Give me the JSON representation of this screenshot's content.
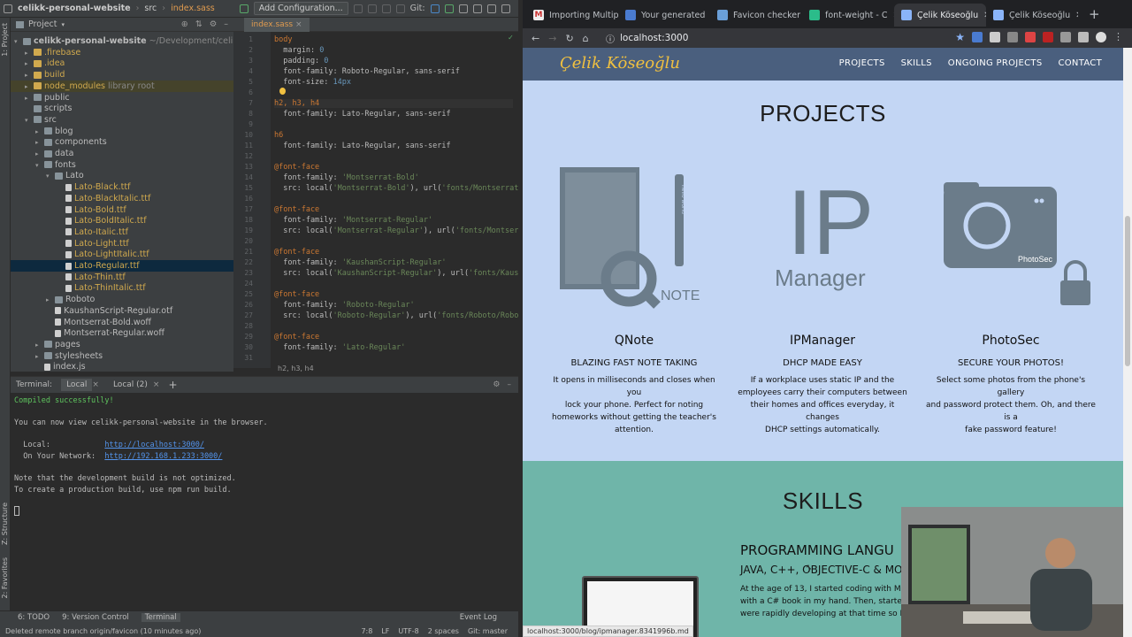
{
  "ide": {
    "breadcrumb_project": "celikk-personal-website",
    "breadcrumb_folder": "src",
    "breadcrumb_file": "index.sass",
    "add_config": "Add Configuration...",
    "git_label": "Git:",
    "project_label": "Project",
    "side_project_label": "1: Project",
    "side_structure_label": "Z: Structure",
    "side_favorites_label": "2: Favorites",
    "tree": [
      {
        "label": "celikk-personal-website",
        "extra": " ~/Development/celikk-person",
        "indent": 0,
        "arrow": "▾",
        "kind": "fold",
        "bold": true
      },
      {
        "label": ".firebase",
        "indent": 1,
        "arrow": "▸",
        "kind": "fold",
        "color": "#d0a94e"
      },
      {
        "label": ".idea",
        "indent": 1,
        "arrow": "▸",
        "kind": "fold",
        "color": "#d0a94e"
      },
      {
        "label": "build",
        "indent": 1,
        "arrow": "▸",
        "kind": "fold",
        "color": "#d0a94e"
      },
      {
        "label": "node_modules",
        "extra": " library root",
        "indent": 1,
        "arrow": "▸",
        "kind": "fold",
        "color": "#d0a94e",
        "hl": true
      },
      {
        "label": "public",
        "indent": 1,
        "arrow": "▸",
        "kind": "fold"
      },
      {
        "label": "scripts",
        "indent": 1,
        "arrow": "",
        "kind": "fold"
      },
      {
        "label": "src",
        "indent": 1,
        "arrow": "▾",
        "kind": "fold"
      },
      {
        "label": "blog",
        "indent": 2,
        "arrow": "▸",
        "kind": "fold"
      },
      {
        "label": "components",
        "indent": 2,
        "arrow": "▸",
        "kind": "fold"
      },
      {
        "label": "data",
        "indent": 2,
        "arrow": "▸",
        "kind": "fold"
      },
      {
        "label": "fonts",
        "indent": 2,
        "arrow": "▾",
        "kind": "fold"
      },
      {
        "label": "Lato",
        "indent": 3,
        "arrow": "▾",
        "kind": "fold"
      },
      {
        "label": "Lato-Black.ttf",
        "indent": 4,
        "arrow": "",
        "kind": "file",
        "color": "#d0a94e"
      },
      {
        "label": "Lato-BlackItalic.ttf",
        "indent": 4,
        "arrow": "",
        "kind": "file",
        "color": "#d0a94e"
      },
      {
        "label": "Lato-Bold.ttf",
        "indent": 4,
        "arrow": "",
        "kind": "file",
        "color": "#d0a94e"
      },
      {
        "label": "Lato-BoldItalic.ttf",
        "indent": 4,
        "arrow": "",
        "kind": "file",
        "color": "#d0a94e"
      },
      {
        "label": "Lato-Italic.ttf",
        "indent": 4,
        "arrow": "",
        "kind": "file",
        "color": "#d0a94e"
      },
      {
        "label": "Lato-Light.ttf",
        "indent": 4,
        "arrow": "",
        "kind": "file",
        "color": "#d0a94e"
      },
      {
        "label": "Lato-LightItalic.ttf",
        "indent": 4,
        "arrow": "",
        "kind": "file",
        "color": "#d0a94e"
      },
      {
        "label": "Lato-Regular.ttf",
        "indent": 4,
        "arrow": "",
        "kind": "file",
        "color": "#d0a94e",
        "sel": true
      },
      {
        "label": "Lato-Thin.ttf",
        "indent": 4,
        "arrow": "",
        "kind": "file",
        "color": "#d0a94e"
      },
      {
        "label": "Lato-ThinItalic.ttf",
        "indent": 4,
        "arrow": "",
        "kind": "file",
        "color": "#d0a94e"
      },
      {
        "label": "Roboto",
        "indent": 3,
        "arrow": "▸",
        "kind": "fold"
      },
      {
        "label": "KaushanScript-Regular.otf",
        "indent": 3,
        "arrow": "",
        "kind": "file"
      },
      {
        "label": "Montserrat-Bold.woff",
        "indent": 3,
        "arrow": "",
        "kind": "file"
      },
      {
        "label": "Montserrat-Regular.woff",
        "indent": 3,
        "arrow": "",
        "kind": "file"
      },
      {
        "label": "pages",
        "indent": 2,
        "arrow": "▸",
        "kind": "fold"
      },
      {
        "label": "stylesheets",
        "indent": 2,
        "arrow": "▸",
        "kind": "fold"
      },
      {
        "label": "index.js",
        "indent": 2,
        "arrow": "",
        "kind": "file"
      }
    ],
    "editor_tab": "index.sass",
    "code": [
      [
        {
          "t": "body",
          "c": "k"
        }
      ],
      [
        {
          "t": "  margin: ",
          "c": "p"
        },
        {
          "t": "0",
          "c": "n"
        }
      ],
      [
        {
          "t": "  padding: ",
          "c": "p"
        },
        {
          "t": "0",
          "c": "n"
        }
      ],
      [
        {
          "t": "  font-family: Roboto-Regular, sans-serif",
          "c": "p"
        }
      ],
      [
        {
          "t": "  font-size: ",
          "c": "p"
        },
        {
          "t": "14px",
          "c": "n"
        }
      ],
      [
        {
          "t": "",
          "c": "p"
        }
      ],
      [
        {
          "t": "h2, h3, h4",
          "c": "k"
        }
      ],
      [
        {
          "t": "  font-family: Lato-Regular, sans-serif",
          "c": "p"
        }
      ],
      [
        {
          "t": "",
          "c": "p"
        }
      ],
      [
        {
          "t": "h6",
          "c": "k"
        }
      ],
      [
        {
          "t": "  font-family: Lato-Regular, sans-serif",
          "c": "p"
        }
      ],
      [
        {
          "t": "",
          "c": "p"
        }
      ],
      [
        {
          "t": "@font-face",
          "c": "k"
        }
      ],
      [
        {
          "t": "  font-family: ",
          "c": "p"
        },
        {
          "t": "'Montserrat-Bold'",
          "c": "s"
        }
      ],
      [
        {
          "t": "  src: local(",
          "c": "p"
        },
        {
          "t": "'Montserrat-Bold'",
          "c": "s"
        },
        {
          "t": "), url(",
          "c": "p"
        },
        {
          "t": "'fonts/Montserrat-Bold",
          "c": "s"
        }
      ],
      [
        {
          "t": "",
          "c": "p"
        }
      ],
      [
        {
          "t": "@font-face",
          "c": "k"
        }
      ],
      [
        {
          "t": "  font-family: ",
          "c": "p"
        },
        {
          "t": "'Montserrat-Regular'",
          "c": "s"
        }
      ],
      [
        {
          "t": "  src: local(",
          "c": "p"
        },
        {
          "t": "'Montserrat-Regular'",
          "c": "s"
        },
        {
          "t": "), url(",
          "c": "p"
        },
        {
          "t": "'fonts/Montserrat-R",
          "c": "s"
        }
      ],
      [
        {
          "t": "",
          "c": "p"
        }
      ],
      [
        {
          "t": "@font-face",
          "c": "k"
        }
      ],
      [
        {
          "t": "  font-family: ",
          "c": "p"
        },
        {
          "t": "'KaushanScript-Regular'",
          "c": "s"
        }
      ],
      [
        {
          "t": "  src: local(",
          "c": "p"
        },
        {
          "t": "'KaushanScript-Regular'",
          "c": "s"
        },
        {
          "t": "), url(",
          "c": "p"
        },
        {
          "t": "'fonts/Kaushan",
          "c": "s"
        }
      ],
      [
        {
          "t": "",
          "c": "p"
        }
      ],
      [
        {
          "t": "@font-face",
          "c": "k"
        }
      ],
      [
        {
          "t": "  font-family: ",
          "c": "p"
        },
        {
          "t": "'Roboto-Regular'",
          "c": "s"
        }
      ],
      [
        {
          "t": "  src: local(",
          "c": "p"
        },
        {
          "t": "'Roboto-Regular'",
          "c": "s"
        },
        {
          "t": "), url(",
          "c": "p"
        },
        {
          "t": "'fonts/Roboto/Roboto-Re",
          "c": "s"
        }
      ],
      [
        {
          "t": "",
          "c": "p"
        }
      ],
      [
        {
          "t": "@font-face",
          "c": "k"
        }
      ],
      [
        {
          "t": "  font-family: ",
          "c": "p"
        },
        {
          "t": "'Lato-Regular'",
          "c": "s"
        }
      ],
      [
        {
          "t": "",
          "c": "p"
        }
      ]
    ],
    "editor_crumb": "h2, h3, h4",
    "terminal_label": "Terminal:",
    "terminal_tabs": [
      "Local",
      "Local (2)"
    ],
    "terminal_lines": [
      {
        "t": "Compiled successfully!",
        "c": "grn"
      },
      {
        "t": "",
        "c": ""
      },
      {
        "t": "You can now view celikk-personal-website in the browser.",
        "c": ""
      },
      {
        "t": "",
        "c": ""
      },
      {
        "t": "  Local:            ",
        "c": "",
        "link": "http://localhost:3000/"
      },
      {
        "t": "  On Your Network:  ",
        "c": "",
        "link": "http://192.168.1.233:3000/"
      },
      {
        "t": "",
        "c": ""
      },
      {
        "t": "Note that the development build is not optimized.",
        "c": ""
      },
      {
        "t": "To create a production build, use npm run build.",
        "c": ""
      }
    ],
    "bottom_tools": [
      "6: TODO",
      "9: Version Control",
      "Terminal"
    ],
    "event_log": "Event Log",
    "status_left": "Deleted remote branch origin/favicon (10 minutes ago)",
    "status_right": [
      "7:8",
      "LF",
      "UTF-8",
      "2 spaces",
      "Git: master"
    ]
  },
  "browser": {
    "tabs": [
      {
        "title": "Importing Multip",
        "fav": "#eeeeee",
        "glyph": "M"
      },
      {
        "title": "Your generated",
        "fav": "#4a7bd0",
        "glyph": ""
      },
      {
        "title": "Favicon checker",
        "fav": "#6a9fd8",
        "glyph": ""
      },
      {
        "title": "font-weight - C",
        "fav": "#2bbc8a",
        "glyph": ""
      },
      {
        "title": "Çelik Köseoğlu",
        "fav": "#8ab4f8",
        "glyph": "",
        "active": true
      },
      {
        "title": "Çelik Köseoğlu",
        "fav": "#8ab4f8",
        "glyph": ""
      }
    ],
    "new_tab": "+",
    "url": "localhost:3000",
    "status_url": "localhost:3000/blog/ipmanager.8341996b.md",
    "site": {
      "logo": "Çelik Köseoğlu",
      "nav": [
        "PROJECTS",
        "SKILLS",
        "ONGOING PROJECTS",
        "CONTACT"
      ],
      "projects_title": "PROJECTS",
      "projects": [
        {
          "name": "QNote",
          "subtitle": "BLAZING FAST NOTE TAKING",
          "desc": [
            "It opens in milliseconds and closes when you",
            "lock your phone. Perfect for noting",
            "homeworks without getting the teacher's",
            "attention."
          ],
          "logo_text": "NOTE",
          "logo_side": "hello world"
        },
        {
          "name": "IPManager",
          "subtitle": "DHCP MADE EASY",
          "desc": [
            "If a workplace uses static IP and the",
            "employees carry their computers between",
            "their homes and offices everyday, it changes",
            "DHCP settings automatically."
          ],
          "logo_big": "IP",
          "logo_small": "Manager"
        },
        {
          "name": "PhotoSec",
          "subtitle": "SECURE YOUR PHOTOS!",
          "desc": [
            "Select some photos from the phone's gallery",
            "and password protect them. Oh, and there is a",
            "fake password feature!"
          ],
          "logo_text": "PhotoSec"
        }
      ],
      "skills_title": "SKILLS",
      "skills_heading": "PROGRAMMING LANGU",
      "skills_sub": "JAVA, C++, OBJECTIVE-C & MO",
      "skills_text": [
        "At the age of 13, I started coding with Micro",
        "with a C# book in my hand. Then, started ma",
        "were rapidly developing at that time so I mad"
      ]
    }
  },
  "colors": {
    "nav_bg": "#4a5f7e",
    "logo": "#f0c040",
    "projects_bg": "#c3d6f4",
    "skills_bg": "#6fb5a9",
    "logo_gray": "#6b7c8a"
  }
}
